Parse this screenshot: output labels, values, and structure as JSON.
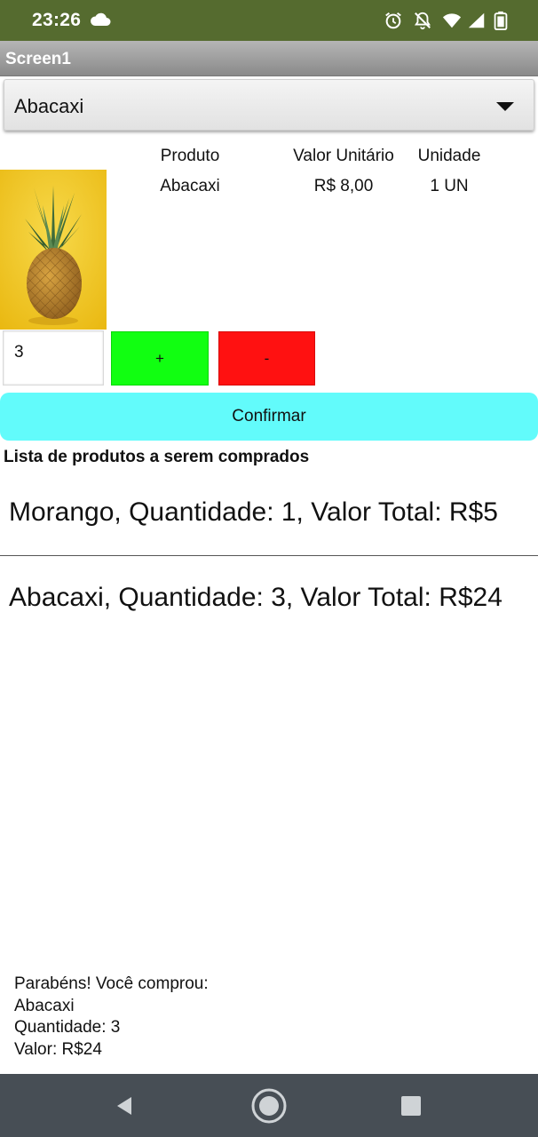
{
  "status_bar": {
    "time": "23:26",
    "icons": [
      "cloud-icon",
      "alarm-icon",
      "notifications-off-icon",
      "wifi-icon",
      "signal-icon",
      "battery-icon"
    ]
  },
  "app": {
    "title": "Screen1"
  },
  "spinner": {
    "selected": "Abacaxi"
  },
  "product_table": {
    "headers": [
      "Produto",
      "Valor Unitário",
      "Unidade"
    ],
    "row": [
      "Abacaxi",
      "R$ 8,00",
      "1 UN"
    ]
  },
  "image": {
    "subject": "pineapple on yellow background",
    "background_color": "#f2c81a"
  },
  "quantity": {
    "value": "3"
  },
  "buttons": {
    "plus": "+",
    "minus": "-",
    "confirm": "Confirmar"
  },
  "colors": {
    "status_bar": "#556b2f",
    "plus": "#11ff11",
    "minus": "#ff1111",
    "confirm": "#62fbfb",
    "nav_bar": "#474e55"
  },
  "list": {
    "title": "Lista de produtos a serem comprados",
    "items": [
      "Morango, Quantidade: 1, Valor Total: R$5",
      "Abacaxi, Quantidade: 3, Valor Total: R$24"
    ]
  },
  "message": {
    "lines": [
      "Parabéns! Você comprou:",
      "Abacaxi",
      "Quantidade: 3",
      "Valor: R$24"
    ]
  },
  "nav_bar": {
    "icons": [
      "back-icon",
      "home-icon",
      "recents-icon"
    ]
  }
}
